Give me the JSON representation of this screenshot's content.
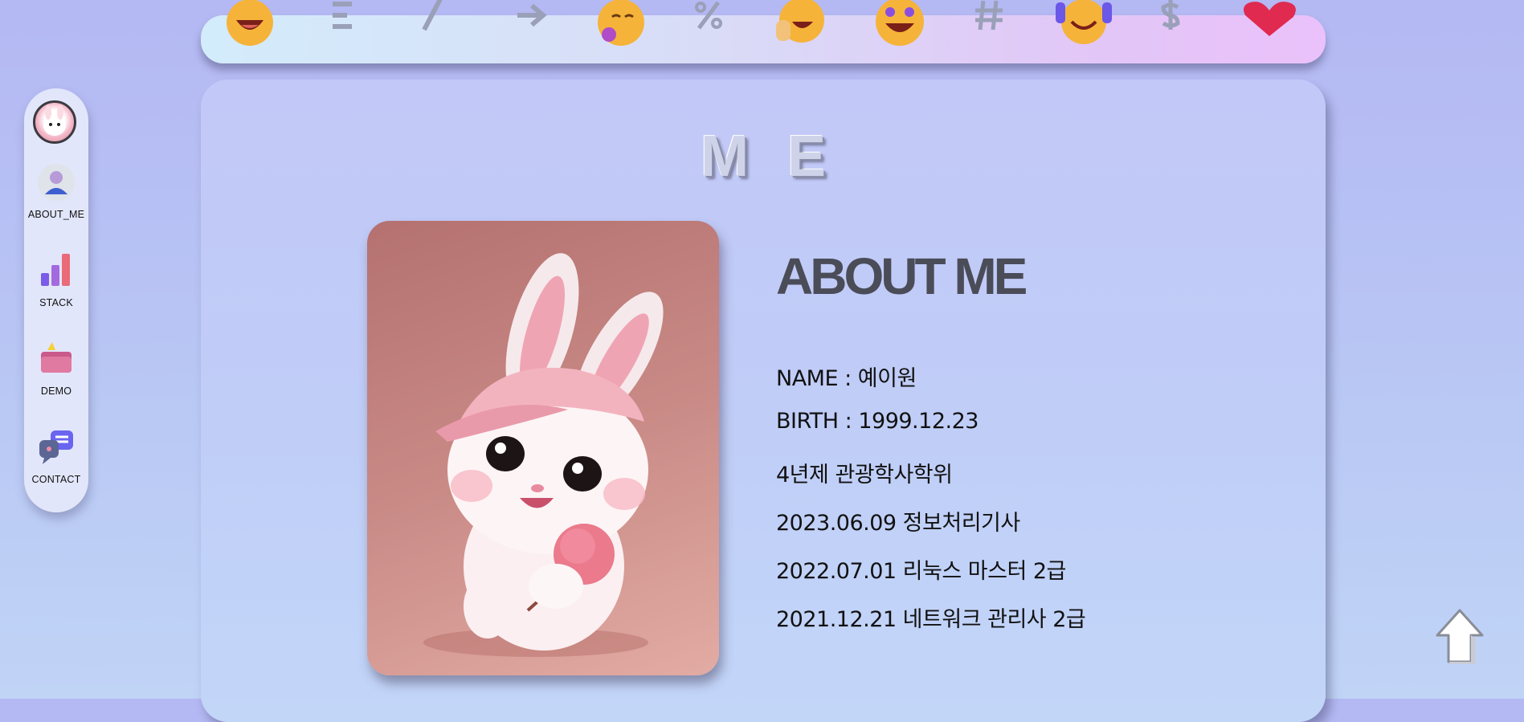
{
  "sidebar": {
    "items": [
      {
        "label": "ABOUT_ME"
      },
      {
        "label": "STACK"
      },
      {
        "label": "DEMO"
      },
      {
        "label": "CONTACT"
      }
    ]
  },
  "main": {
    "section_heading": "ME",
    "about_title": "ABOUT ME",
    "info": [
      "NAME : 예이원",
      "BIRTH : 1999.12.23",
      "4년제 관광학사학위",
      "2023.06.09 정보처리기사",
      "2022.07.01 리눅스 마스터 2급",
      "2021.12.21 네트워크 관리사 2급"
    ]
  },
  "colors": {
    "background": "#b6bcf4",
    "panel": "#c0cdf7",
    "banner_start": "#d3ecfb",
    "banner_end": "#ebc1fb",
    "title_text": "#4a4c58"
  },
  "icons": [
    "smile-emoji-icon",
    "star-struck-emoji-icon",
    "headphone-emoji-icon",
    "heart-emoji-icon",
    "about-me-person-icon",
    "stack-bar-chart-icon",
    "demo-folder-icon",
    "contact-chat-icon",
    "scroll-top-arrow-icon"
  ]
}
